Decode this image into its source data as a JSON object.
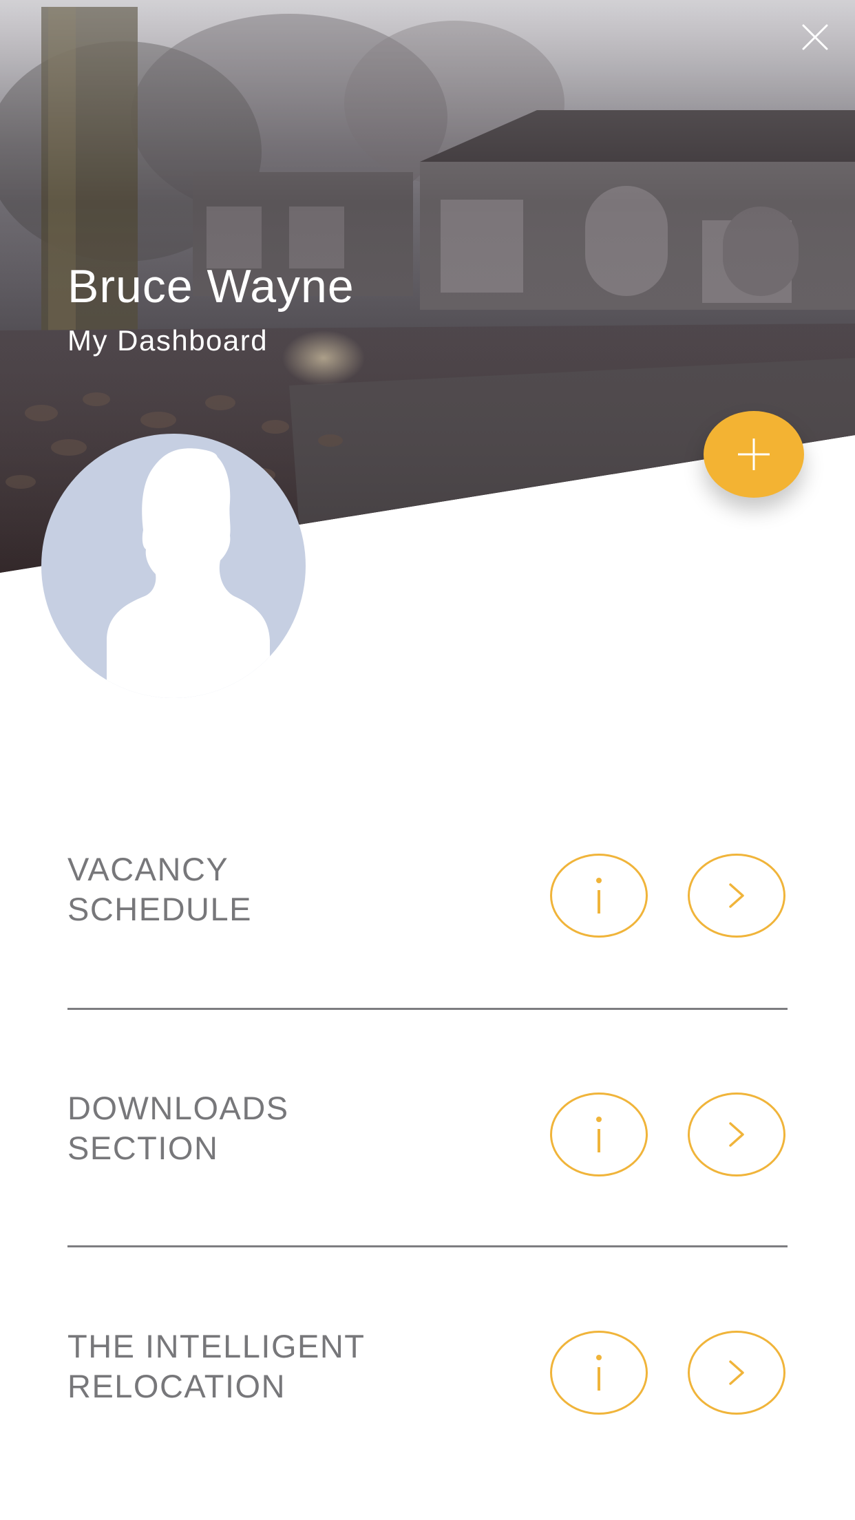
{
  "header": {
    "user_name": "Bruce Wayne",
    "subtitle": "My Dashboard"
  },
  "icons": {
    "close": "close-icon",
    "add": "plus-icon",
    "info": "info-icon",
    "go": "chevron-right-icon",
    "avatar": "user-silhouette"
  },
  "colors": {
    "accent": "#f3b333",
    "label_text": "#77777a",
    "divider": "#7d7d80",
    "avatar_bg": "#c6cfe2",
    "avatar_silhouette": "#ffffff"
  },
  "menu": {
    "items": [
      {
        "line1": "VACANCY",
        "line2": "SCHEDULE"
      },
      {
        "line1": "DOWNLOADS",
        "line2": "SECTION"
      },
      {
        "line1": "THE INTELLIGENT",
        "line2": "RELOCATION"
      }
    ]
  }
}
